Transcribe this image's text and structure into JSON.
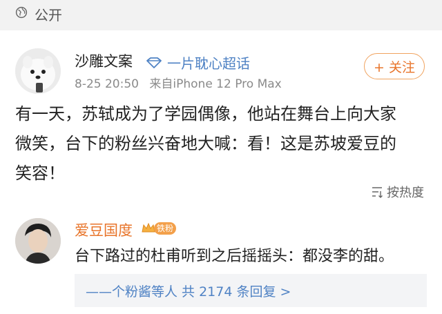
{
  "header": {
    "visibility_label": "公开",
    "icon": "globe-icon"
  },
  "post": {
    "author": "沙雕文案",
    "supertopic_label": "一片耽心超话",
    "supertopic_icon": "diamond-icon",
    "timestamp": "8-25 20:50",
    "source": "来自iPhone 12 Pro Max",
    "follow_label": "+ 关注",
    "lines": [
      "有一天，苏轼成为了学园偶像，他站在舞台上向大家",
      "微笑，台下的粉丝兴奋地大喊：看！这是苏坡爱豆的",
      "笑容！"
    ]
  },
  "comments_section": {
    "sort_label": "按热度",
    "sort_icon": "sort-icon"
  },
  "comment": {
    "author": "爱豆国度",
    "badge_icon": "crown-icon",
    "fan_badge": "铁粉",
    "text": "台下路过的杜甫听到之后摇摇头：都没李的甜。",
    "replies_label": "——个粉酱等人  共 2174 条回复 >"
  },
  "colors": {
    "accent_orange": "#e8742a",
    "link_blue": "#4f82c4",
    "topbar_bg": "#f2f2f2"
  }
}
